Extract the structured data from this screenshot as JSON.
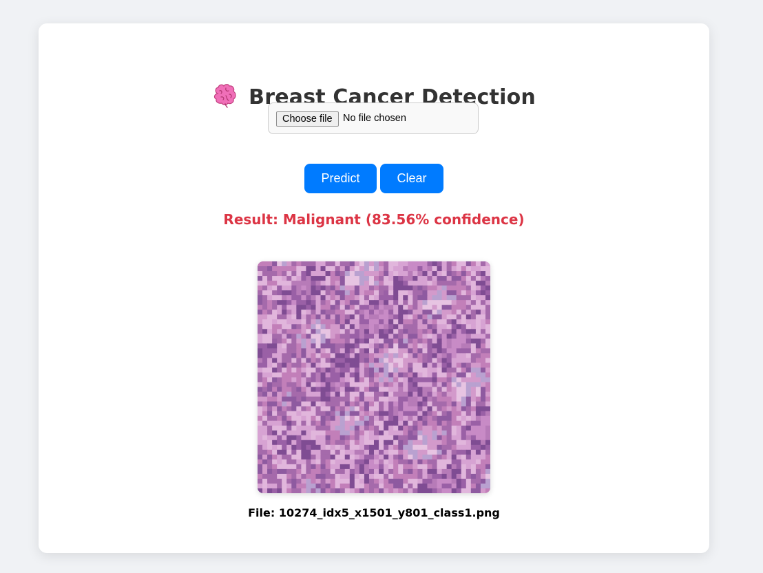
{
  "header": {
    "icon": "brain-icon",
    "title": "Breast Cancer Detection"
  },
  "upload": {
    "choose_label": "Choose file",
    "status": "No file chosen"
  },
  "actions": {
    "predict_label": "Predict",
    "clear_label": "Clear"
  },
  "result": {
    "text": "Result: Malignant (83.56% confidence)"
  },
  "preview": {
    "caption": "File: 10274_idx5_x1501_y801_class1.png"
  },
  "colors": {
    "accent": "#007bff",
    "result": "#dc3545",
    "background": "#f0f2f5",
    "card": "#ffffff"
  }
}
